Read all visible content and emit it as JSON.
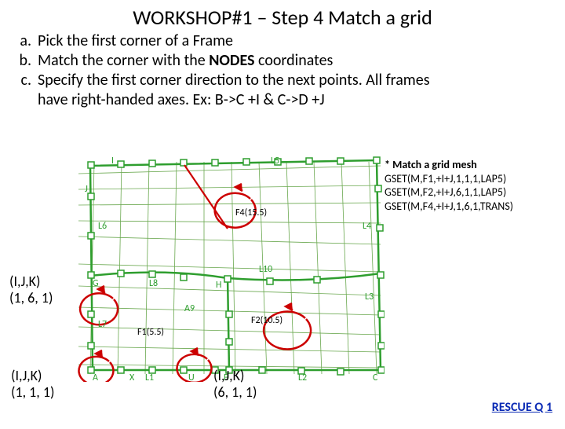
{
  "title": "WORKSHOP#1 – Step 4 Match a grid",
  "steps": {
    "a": "Pick the first corner of a Frame",
    "b_pre": "Match the corner with the ",
    "b_bold": "NODES",
    "b_post": " coordinates",
    "c1": "Specify the first corner direction to the next points. All frames",
    "c2": "have right-handed axes. Ex: B->C +I & C->D +J"
  },
  "note": {
    "title": "* Match a grid mesh",
    "l1": "GSET(M,F1,+I+J,1,1,1,LAP5)",
    "l2": "GSET(M,F2,+I+J,6,1,1,LAP5)",
    "l3": "GSET(M,F4,+I+J,1,6,1,TRANS)"
  },
  "coords": {
    "c1a": "(I,J,K)",
    "c1b": "(1, 6, 1)",
    "c2a": "(I,J,K)",
    "c2b": "(1, 1, 1)",
    "c3a": "(I,J,K)",
    "c3b": "(6, 1, 1)"
  },
  "rescue": "RESCUE Q 1",
  "diagram_labels": {
    "I": "I",
    "J": "J",
    "L5": "L5",
    "L4": "L4",
    "L6": "L6",
    "F4": "F4(15.5)",
    "L10": "L10",
    "L3": "L3",
    "L8": "L8",
    "G": "G",
    "H": "H",
    "L7": "L7",
    "F1": "F1(5.5)",
    "A9": "A9",
    "F2": "F2(10.5)",
    "A": "A",
    "X": "X",
    "L1": "L1",
    "U": "U",
    "B": "B",
    "L2": "L2",
    "C": "C"
  }
}
